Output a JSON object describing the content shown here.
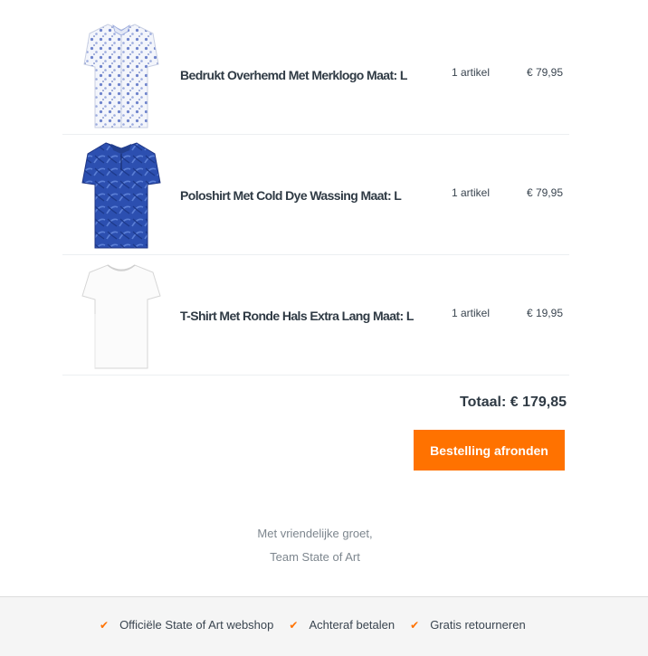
{
  "order": {
    "items": [
      {
        "name": "Bedrukt Overhemd Met Merklogo Maat: L",
        "quantity": "1 artikel",
        "price": "€ 79,95",
        "image": "shirt-white-blue-print"
      },
      {
        "name": "Poloshirt Met Cold Dye Wassing Maat: L",
        "quantity": "1 artikel",
        "price": "€ 79,95",
        "image": "polo-blue"
      },
      {
        "name": "T-Shirt Met Ronde Hals Extra Lang Maat: L",
        "quantity": "1 artikel",
        "price": "€ 19,95",
        "image": "tshirt-white"
      }
    ],
    "total": "Totaal: € 179,85",
    "cta_label": "Bestelling afronden"
  },
  "closing": {
    "line1": "Met vriendelijke groet,",
    "line2": "Team State of Art"
  },
  "footer": {
    "usps": [
      "Officiële State of Art webshop",
      "Achteraf betalen",
      "Gratis retourneren"
    ]
  },
  "colors": {
    "accent": "#ff7200",
    "text": "#2f3a44",
    "muted": "#7d868e"
  }
}
